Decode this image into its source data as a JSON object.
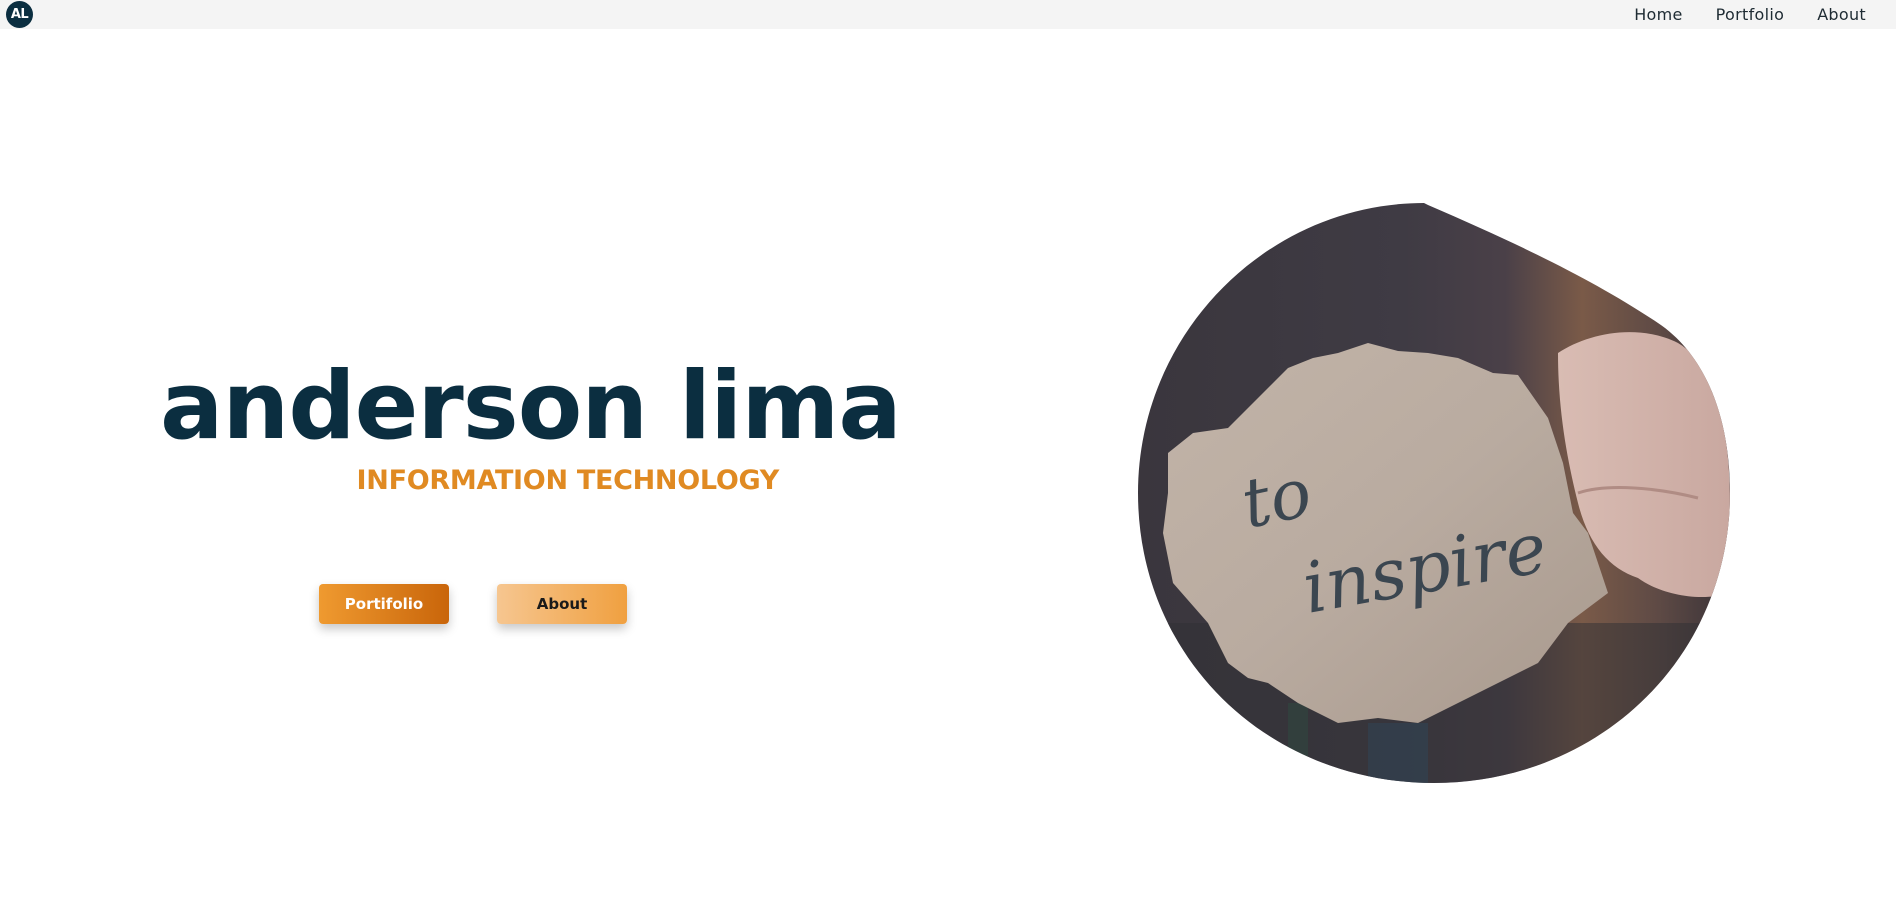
{
  "header": {
    "logo_text": "AL",
    "nav": [
      {
        "label": "Home"
      },
      {
        "label": "Portfolio"
      },
      {
        "label": "About"
      }
    ]
  },
  "hero": {
    "name": "anderson lima",
    "subtitle": "INFORMATION TECHNOLOGY",
    "buttons": {
      "portfolio_label": "Portifolio",
      "about_label": "About"
    },
    "image": {
      "note_text_line1": "to",
      "note_text_line2": "inspire"
    }
  },
  "colors": {
    "brand_dark": "#0b2e40",
    "accent_orange": "#e08a22",
    "nav_background": "#f4f4f4"
  }
}
